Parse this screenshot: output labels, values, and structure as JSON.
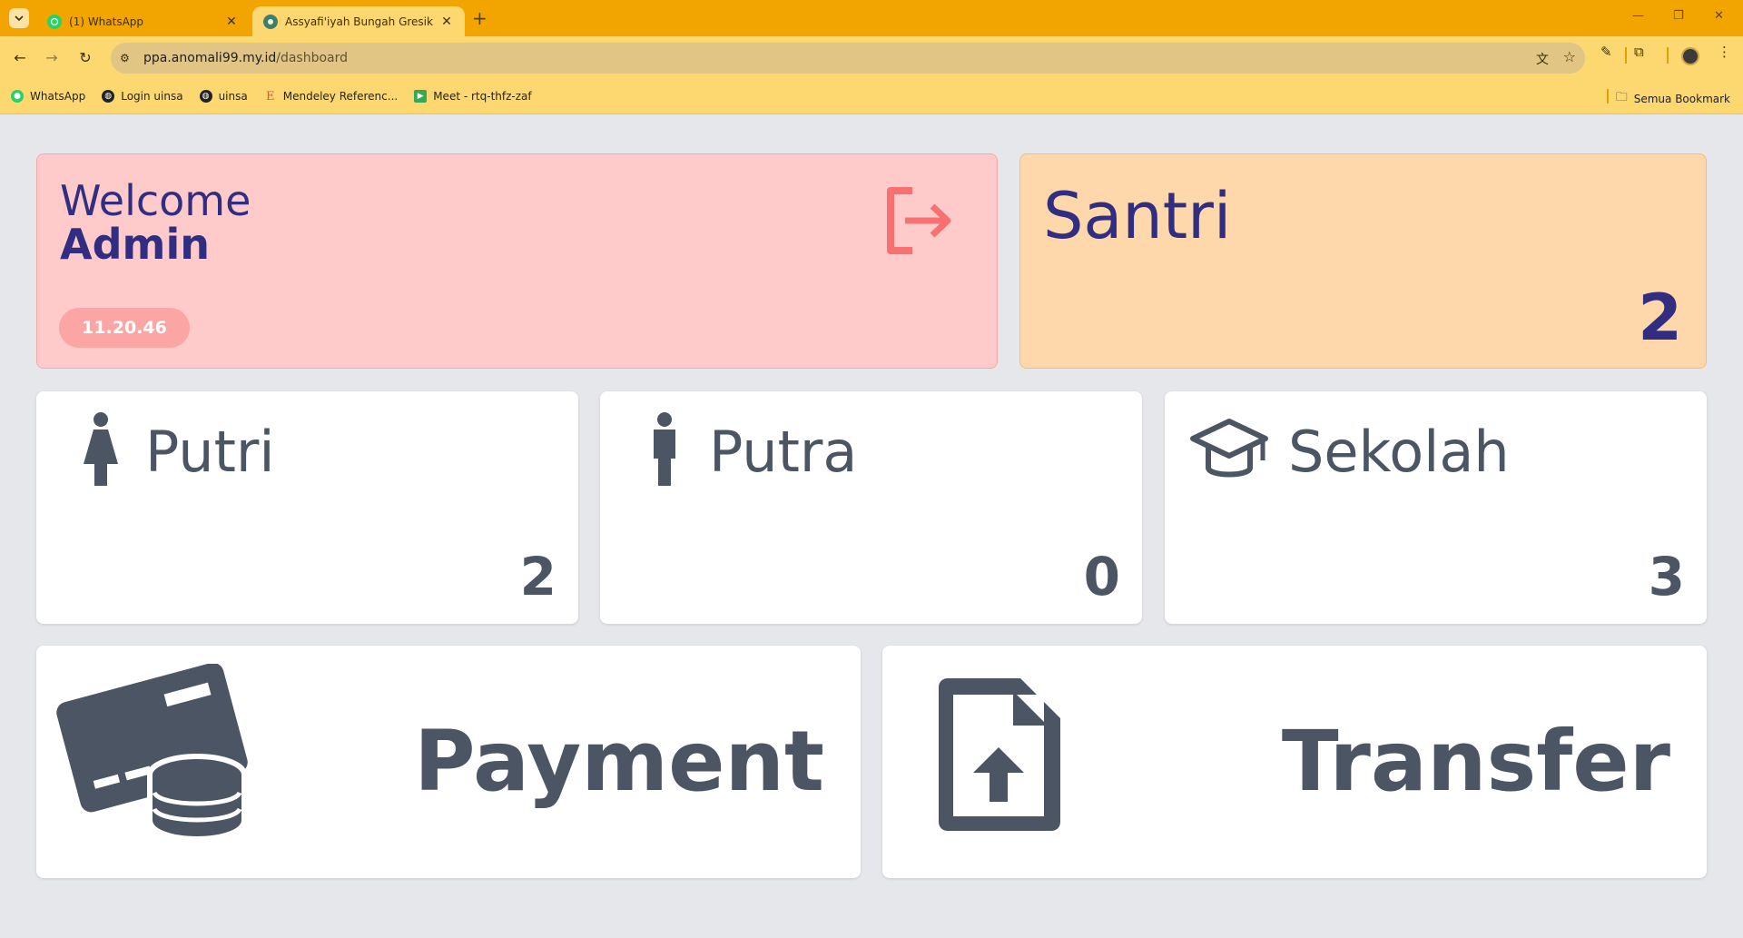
{
  "browser": {
    "tabs": [
      {
        "title": "(1) WhatsApp",
        "active": false
      },
      {
        "title": "Assyafi'iyah Bungah Gresik",
        "active": true
      }
    ],
    "url_host": "ppa.anomali99.my.id",
    "url_path": "/dashboard",
    "bookmarks": [
      {
        "label": "WhatsApp",
        "icon": "whatsapp-icon"
      },
      {
        "label": "Login uinsa",
        "icon": "globe-icon"
      },
      {
        "label": "uinsa",
        "icon": "globe-icon"
      },
      {
        "label": "Mendeley Referenc...",
        "icon": "mendeley-icon"
      },
      {
        "label": "Meet - rtq-thfz-zaf",
        "icon": "meet-icon"
      }
    ],
    "all_bookmarks": "Semua Bookmark"
  },
  "welcome": {
    "label": "Welcome",
    "user": "Admin",
    "clock": "11.20.46"
  },
  "santri": {
    "title": "Santri",
    "count": "2"
  },
  "stats": [
    {
      "title": "Putri",
      "count": "2",
      "icon": "female-icon"
    },
    {
      "title": "Putra",
      "count": "0",
      "icon": "male-icon"
    },
    {
      "title": "Sekolah",
      "count": "3",
      "icon": "graduation-cap-icon"
    }
  ],
  "actions": [
    {
      "label": "Payment",
      "icon": "credit-card-coins-icon"
    },
    {
      "label": "Transfer",
      "icon": "file-upload-icon"
    }
  ],
  "colors": {
    "tabstrip": "#f2a500",
    "toolbar": "#fdd76f",
    "welcome_bg": "#fecaca",
    "santri_bg": "#fed7aa",
    "accent_text": "#312e81",
    "card_text": "#4b5563",
    "logout_icon": "#f87171"
  }
}
